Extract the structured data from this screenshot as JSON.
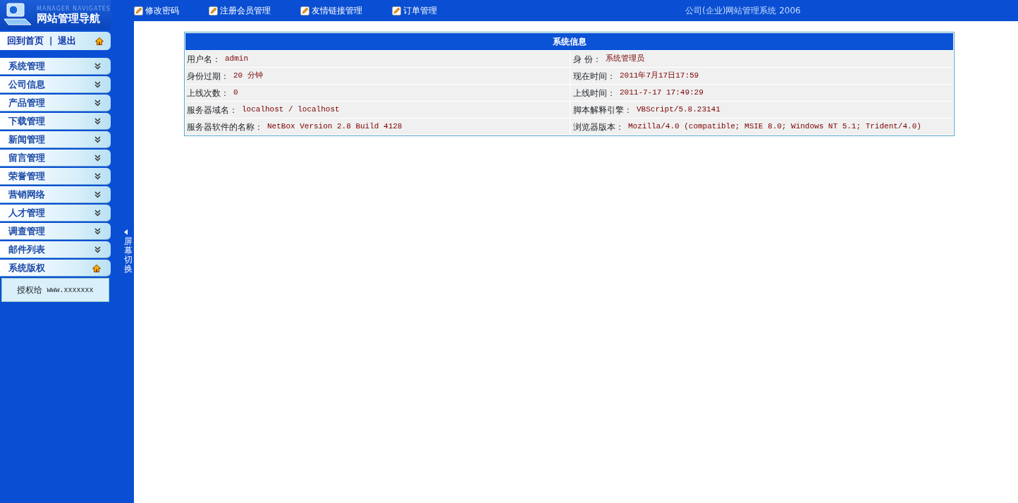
{
  "logo": {
    "subtitle": "MANAGER NAVIGATES",
    "title": "网站管理导航"
  },
  "home_bar": {
    "links": [
      "回到首页",
      "退出"
    ],
    "separator": "|"
  },
  "sidebar": {
    "items": [
      {
        "label": "系统管理",
        "expanded": false
      },
      {
        "label": "公司信息",
        "expanded": false
      },
      {
        "label": "产品管理",
        "expanded": false
      },
      {
        "label": "下载管理",
        "expanded": false
      },
      {
        "label": "新闻管理",
        "expanded": false
      },
      {
        "label": "留言管理",
        "expanded": false
      },
      {
        "label": "荣誉管理",
        "expanded": false
      },
      {
        "label": "营销网络",
        "expanded": false
      },
      {
        "label": "人才管理",
        "expanded": false
      },
      {
        "label": "调查管理",
        "expanded": false
      },
      {
        "label": "邮件列表",
        "expanded": false
      },
      {
        "label": "系统版权",
        "expanded": true,
        "content": {
          "label": "授权给",
          "value": "www.xxxxxxx"
        }
      }
    ]
  },
  "splitter": {
    "label": "屏幕切换"
  },
  "top_links": [
    "修改密码",
    "注册会员管理",
    "友情链接管理",
    "订单管理"
  ],
  "system_name": "公司(企业)网站管理系统 2006",
  "info_table": {
    "title": "系统信息",
    "rows": [
      [
        {
          "label": "用户名：",
          "value": "admin"
        },
        {
          "label": "身 份：",
          "value": "系统管理员"
        }
      ],
      [
        {
          "label": "身份过期：",
          "value": "20 分钟"
        },
        {
          "label": "现在时间：",
          "value": "2011年7月17日17:59"
        }
      ],
      [
        {
          "label": "上线次数：",
          "value": "0"
        },
        {
          "label": "上线时间：",
          "value": "2011-7-17 17:49:29"
        }
      ],
      [
        {
          "label": "服务器域名：",
          "value": "localhost / localhost"
        },
        {
          "label": "脚本解释引擎：",
          "value": "VBScript/5.8.23141"
        }
      ],
      [
        {
          "label": "服务器软件的名称：",
          "value": "NetBox Version 2.8 Build 4128"
        },
        {
          "label": "浏览器版本：",
          "value": "Mozilla/4.0 (compatible; MSIE 8.0; Windows NT 5.1; Trident/4.0)"
        }
      ]
    ]
  }
}
